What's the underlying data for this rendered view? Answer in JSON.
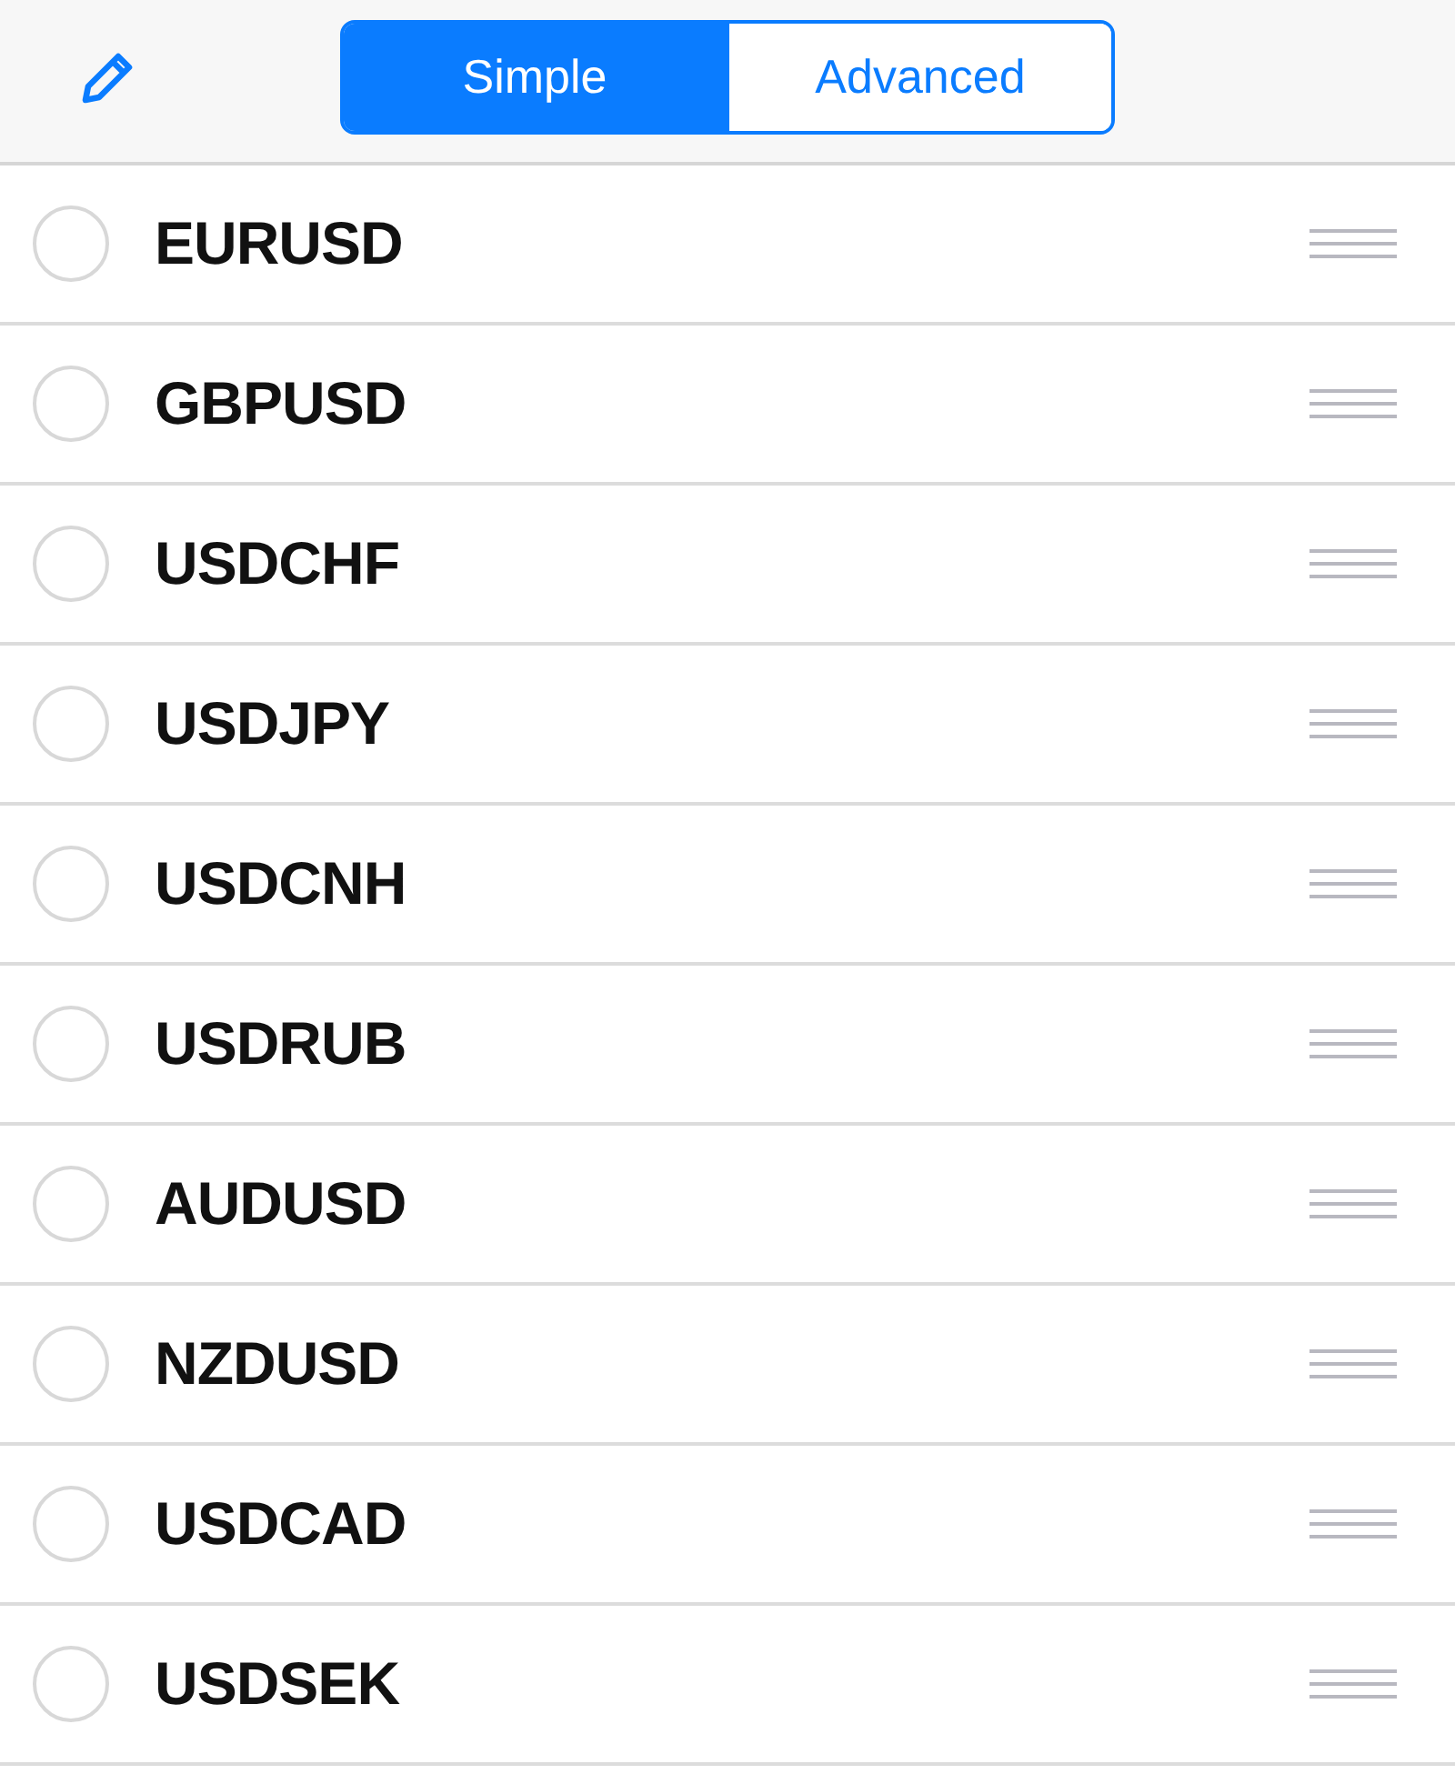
{
  "segments": [
    {
      "label": "Simple",
      "selected": true
    },
    {
      "label": "Advanced",
      "selected": false
    }
  ],
  "symbols": [
    {
      "name": "EURUSD",
      "selected": false
    },
    {
      "name": "GBPUSD",
      "selected": false
    },
    {
      "name": "USDCHF",
      "selected": false
    },
    {
      "name": "USDJPY",
      "selected": false
    },
    {
      "name": "USDCNH",
      "selected": false
    },
    {
      "name": "USDRUB",
      "selected": false
    },
    {
      "name": "AUDUSD",
      "selected": false
    },
    {
      "name": "NZDUSD",
      "selected": false
    },
    {
      "name": "USDCAD",
      "selected": false
    },
    {
      "name": "USDSEK",
      "selected": false
    }
  ]
}
